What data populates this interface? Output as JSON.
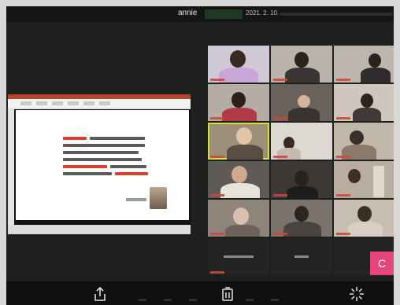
{
  "topbar": {
    "user_name": "annie",
    "date": "2021. 2. 10."
  },
  "gallery": {
    "self_avatar_letter": "C"
  },
  "colors": {
    "active_speaker": "#cfe23a",
    "self_avatar": "#e8457a",
    "slide_accent": "#d9412c"
  },
  "icons": [
    "share-icon",
    "participants-icon",
    "sparkle-icon"
  ]
}
